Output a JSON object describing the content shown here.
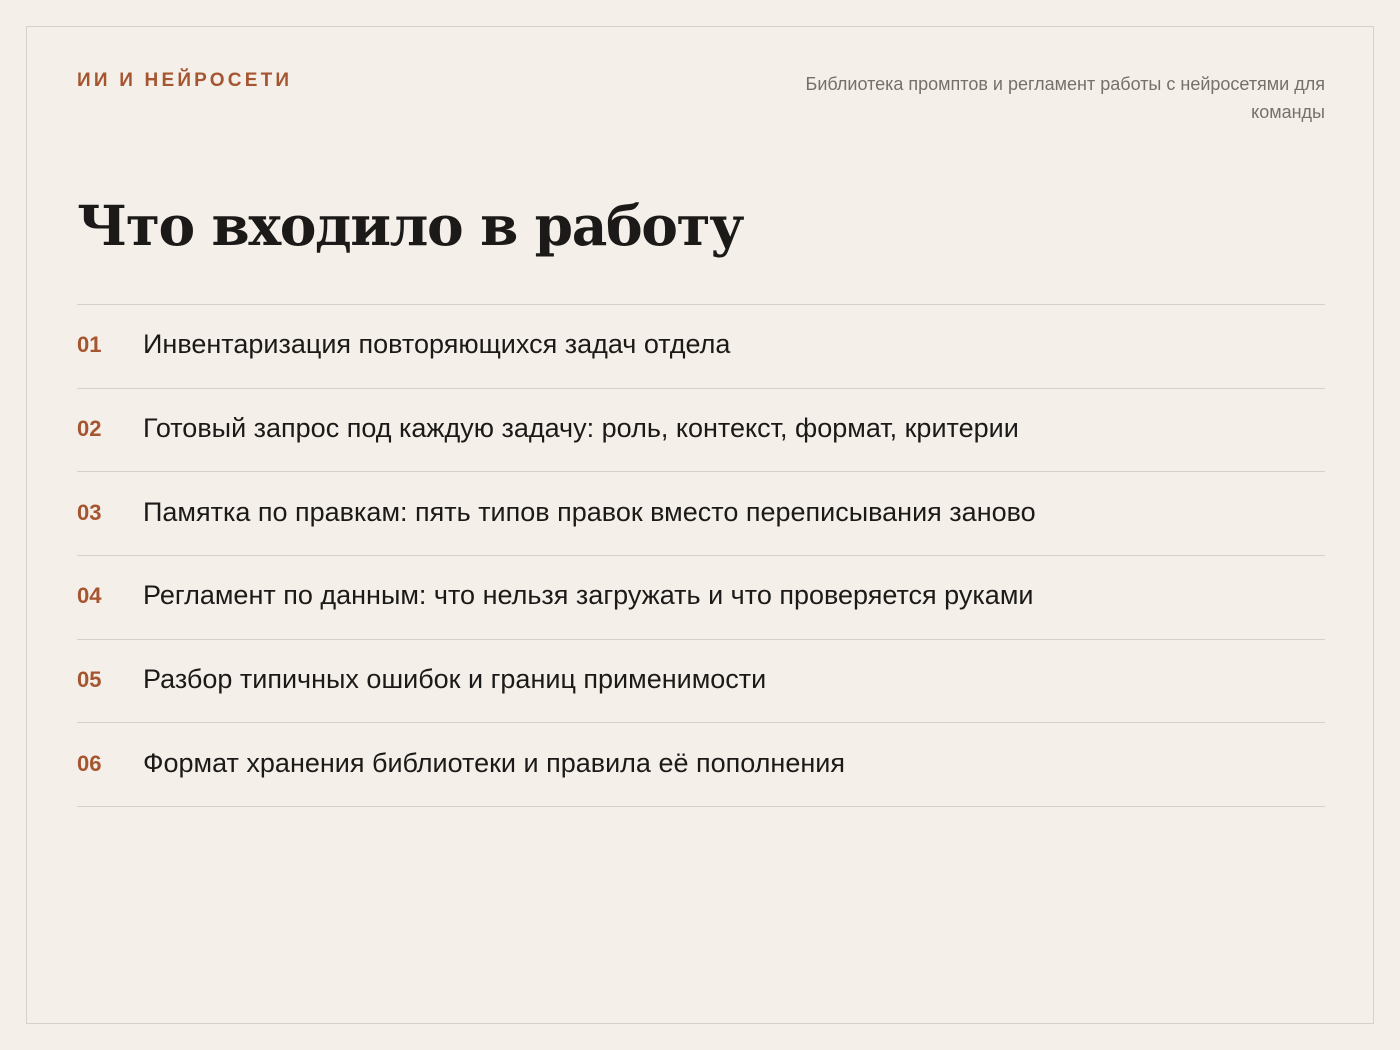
{
  "header": {
    "kicker": "ИИ И НЕЙРОСЕТИ",
    "subtitle": "Библиотека промптов и регламент работы с нейросетями для команды"
  },
  "main": {
    "title": "Что входило в работу",
    "items": [
      {
        "number": "01",
        "text": "Инвентаризация повторяющихся задач отдела"
      },
      {
        "number": "02",
        "text": "Готовый запрос под каждую задачу: роль, контекст, формат, критерии"
      },
      {
        "number": "03",
        "text": "Памятка по правкам: пять типов правок вместо переписывания заново"
      },
      {
        "number": "04",
        "text": "Регламент по данным: что нельзя загружать и что проверяется руками"
      },
      {
        "number": "05",
        "text": "Разбор типичных ошибок и границ применимости"
      },
      {
        "number": "06",
        "text": "Формат хранения библиотеки и правила её пополнения"
      }
    ]
  },
  "colors": {
    "background": "#f4efe9",
    "accent": "#a5552f",
    "text": "#1c1a18",
    "muted": "#76706a",
    "divider": "#d8d1c9"
  }
}
